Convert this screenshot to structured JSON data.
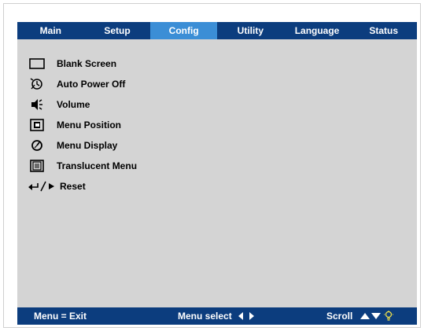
{
  "tabs": [
    {
      "label": "Main",
      "active": false
    },
    {
      "label": "Setup",
      "active": false
    },
    {
      "label": "Config",
      "active": true
    },
    {
      "label": "Utility",
      "active": false
    },
    {
      "label": "Language",
      "active": false
    },
    {
      "label": "Status",
      "active": false
    }
  ],
  "menu": {
    "items": [
      {
        "label": "Blank Screen",
        "icon": "blank-screen-icon"
      },
      {
        "label": "Auto Power Off",
        "icon": "auto-power-off-icon"
      },
      {
        "label": "Volume",
        "icon": "volume-icon"
      },
      {
        "label": "Menu Position",
        "icon": "menu-position-icon"
      },
      {
        "label": "Menu Display",
        "icon": "menu-display-icon"
      },
      {
        "label": "Translucent Menu",
        "icon": "translucent-menu-icon"
      },
      {
        "label": "Reset",
        "icon": "reset-icon"
      }
    ]
  },
  "footer": {
    "exit": "Menu = Exit",
    "select": "Menu select",
    "scroll": "Scroll"
  },
  "colors": {
    "bar": "#0c3d7e",
    "active_tab": "#3b8ed6",
    "panel": "#d4d4d4"
  }
}
